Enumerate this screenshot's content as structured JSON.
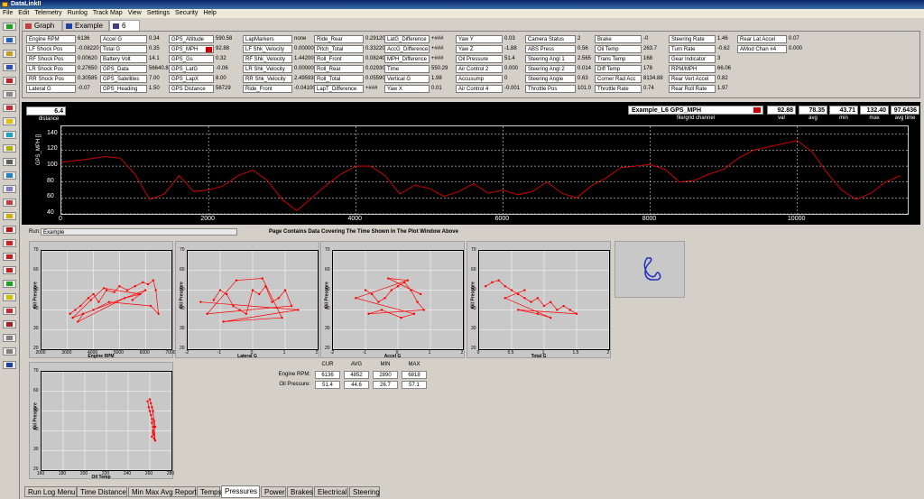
{
  "window": {
    "title": "DataLinkII"
  },
  "menu": [
    "File",
    "Edit",
    "Telemetry",
    "Runlog",
    "Track Map",
    "View",
    "Settings",
    "Security",
    "Help"
  ],
  "tabs": [
    {
      "label": "Graph"
    },
    {
      "label": "Example"
    },
    {
      "label": "6"
    }
  ],
  "channels": [
    {
      "label": "Engine RPM",
      "value": "6136"
    },
    {
      "label": "LF Shock Pos",
      "value": "-0.08220"
    },
    {
      "label": "RF Shock Pos",
      "value": "0.00620"
    },
    {
      "label": "LR Shock Pos",
      "value": "0.27650"
    },
    {
      "label": "RR Shock Pos",
      "value": "0.30585"
    },
    {
      "label": "Lateral G",
      "value": "-0.07"
    },
    {
      "label": "Accel G",
      "value": "0.34"
    },
    {
      "label": "Total G",
      "value": "0.35"
    },
    {
      "label": "Battery Volt",
      "value": "14.1"
    },
    {
      "label": "GPS_Data",
      "value": "56640.85"
    },
    {
      "label": "GPS_Satellites",
      "value": "7.00"
    },
    {
      "label": "GPS_Heading",
      "value": "1.50"
    },
    {
      "label": "GPS_Altitude",
      "value": "590.58"
    },
    {
      "label": "GPS_MPH",
      "value": "92.88"
    },
    {
      "label": "GPS_Gs",
      "value": "0.32"
    },
    {
      "label": "GPS_LatG",
      "value": "-0.06"
    },
    {
      "label": "GPS_LapX",
      "value": "8.00"
    },
    {
      "label": "GPS Distance",
      "value": "56729"
    },
    {
      "label": "LapMarkers",
      "value": "none"
    },
    {
      "label": "LF Shk_Velocity",
      "value": "0.00000"
    },
    {
      "label": "RF Shk_Velocity",
      "value": "1.44200"
    },
    {
      "label": "LR Shk_Velocity",
      "value": "0.00000"
    },
    {
      "label": "RR Shk_Velocity",
      "value": "2.49593"
    },
    {
      "label": "Ride_Front",
      "value": "-0.04100"
    },
    {
      "label": "Ride_Rear",
      "value": "0.29120"
    },
    {
      "label": "Pitch_Total",
      "value": "0.33220"
    },
    {
      "label": "Roll_Front",
      "value": "0.08240"
    },
    {
      "label": "Roll_Rear",
      "value": "0.02930"
    },
    {
      "label": "Roll_Total",
      "value": "0.05590"
    },
    {
      "label": "LapT_Difference",
      "value": "+###"
    },
    {
      "label": "LatG_Difference",
      "value": "+###"
    },
    {
      "label": "AccG_Difference",
      "value": "+###"
    },
    {
      "label": "MPH_Difference",
      "value": "+###"
    },
    {
      "label": "Time",
      "value": "550.29"
    },
    {
      "label": "Vertical G",
      "value": "1.98"
    },
    {
      "label": "Yaw X",
      "value": "0.01"
    },
    {
      "label": "Yaw Y",
      "value": "0.03"
    },
    {
      "label": "Yaw Z",
      "value": "-1.88"
    },
    {
      "label": "Oil Pressure",
      "value": "51.4"
    },
    {
      "label": "Air Control 2",
      "value": "0.000"
    },
    {
      "label": "Accusump",
      "value": "0"
    },
    {
      "label": "Air Control 4",
      "value": "-0.001"
    },
    {
      "label": "Camera Status",
      "value": "2"
    },
    {
      "label": "ABS Press",
      "value": "0.56"
    },
    {
      "label": "Steering Angl 1",
      "value": "2.565"
    },
    {
      "label": "Steering Angl 2",
      "value": "0.014"
    },
    {
      "label": "Steering Angle",
      "value": "0.63"
    },
    {
      "label": "Throttle Pos",
      "value": "101.0"
    },
    {
      "label": "Brake",
      "value": "-0"
    },
    {
      "label": "Oil Temp",
      "value": "263.7"
    },
    {
      "label": "Trans Temp",
      "value": "168"
    },
    {
      "label": "Diff Temp",
      "value": "178"
    },
    {
      "label": "Corner Rad Acc",
      "value": "8134.88"
    },
    {
      "label": "Throttle Rate",
      "value": "0.74"
    },
    {
      "label": "Steering Rate",
      "value": "1.46"
    },
    {
      "label": "Turn Rate",
      "value": "-0.62"
    },
    {
      "label": "Gear Indicator",
      "value": "3"
    },
    {
      "label": "RPM/MPH",
      "value": "66.06"
    },
    {
      "label": "Rear Vert Accel",
      "value": "0.82"
    },
    {
      "label": "Rear Roll Rate",
      "value": "1.97"
    },
    {
      "label": "Rear Lat Accel",
      "value": "0.07"
    },
    {
      "label": "AMod Chan #4",
      "value": "0.000"
    }
  ],
  "graph": {
    "distance_value": "6.4",
    "distance_label": "distance",
    "channel_selector": "Example_L6   GPS_MPH",
    "file_grid_label": "file/grid channel",
    "stats": [
      {
        "label": "val",
        "value": "92.88"
      },
      {
        "label": "avg",
        "value": "78.35"
      },
      {
        "label": "min",
        "value": "43.71"
      },
      {
        "label": "max",
        "value": "132.40"
      },
      {
        "label": "avg time",
        "value": "97.6436"
      }
    ],
    "line_color": "#cc0000",
    "grid_color": "#ffffff"
  },
  "run": {
    "label": "Run:",
    "value": "Example",
    "message": "Page Contains Data Covering The Time Shown In The Plot Window Above"
  },
  "scatter_stats": {
    "headers": [
      "CUR",
      "AVG",
      "MIN",
      "MAX"
    ],
    "rows": [
      {
        "label": "Engine RPM:",
        "values": [
          "6136",
          "4852",
          "2890",
          "6818"
        ]
      },
      {
        "label": "Oil Pressure:",
        "values": [
          "51.4",
          "44.6",
          "26.7",
          "57.1"
        ]
      }
    ]
  },
  "bottom_tabs": [
    {
      "label": "Run Log Menu"
    },
    {
      "label": "Time Distance"
    },
    {
      "label": "Min Max Avg Report"
    },
    {
      "label": "Temps"
    },
    {
      "label": "Pressures"
    },
    {
      "label": "Power"
    },
    {
      "label": "Brakes"
    },
    {
      "label": "Electrical"
    },
    {
      "label": "Steering"
    }
  ],
  "active_tab": "Pressures",
  "chart_data": [
    {
      "type": "line",
      "ylabel": "GPS_MPH []",
      "xlim": [
        0,
        11500
      ],
      "ylim": [
        40,
        150
      ],
      "yticks": [
        40,
        60,
        80,
        100,
        120,
        140
      ],
      "xticks": [
        0,
        2000,
        4000,
        6000,
        8000,
        10000
      ],
      "series": [
        {
          "name": "GPS_MPH",
          "x": [
            0,
            300,
            600,
            800,
            1000,
            1200,
            1400,
            1600,
            1800,
            2000,
            2200,
            2400,
            2600,
            2800,
            3000,
            3200,
            3400,
            3600,
            3800,
            4000,
            4200,
            4400,
            4600,
            4800,
            5000,
            5200,
            5400,
            5600,
            5800,
            6000,
            6200,
            6400,
            6600,
            6800,
            7000,
            7200,
            7400,
            7600,
            7800,
            8000,
            8200,
            8400,
            8600,
            8800,
            9000,
            9200,
            9400,
            9600,
            9800,
            10000,
            10200,
            10400,
            10600,
            10800,
            11000,
            11200,
            11400
          ],
          "y": [
            105,
            108,
            112,
            110,
            90,
            58,
            65,
            88,
            68,
            70,
            75,
            88,
            95,
            82,
            58,
            44,
            60,
            76,
            90,
            100,
            100,
            88,
            65,
            76,
            72,
            62,
            68,
            78,
            66,
            70,
            64,
            68,
            80,
            66,
            60,
            75,
            85,
            98,
            100,
            102,
            96,
            80,
            82,
            90,
            96,
            110,
            120,
            124,
            128,
            132,
            118,
            92,
            70,
            58,
            66,
            80,
            88
          ]
        }
      ]
    },
    {
      "type": "scatter",
      "xlabel": "Engine RPM",
      "ylabel": "Oil Pressure",
      "xlim": [
        2000,
        7000
      ],
      "ylim": [
        20,
        70
      ],
      "xticks": [
        2000,
        3000,
        4000,
        5000,
        6000,
        7000
      ],
      "yticks": [
        20,
        30,
        40,
        50,
        60,
        70
      ],
      "series": [
        {
          "name": "Oil Pressure",
          "points": [
            [
              3100,
              38
            ],
            [
              3300,
              40
            ],
            [
              3500,
              42
            ],
            [
              3800,
              46
            ],
            [
              4000,
              48
            ],
            [
              4200,
              44
            ],
            [
              4500,
              50
            ],
            [
              4800,
              49
            ],
            [
              5000,
              52
            ],
            [
              5300,
              50
            ],
            [
              5600,
              52
            ],
            [
              5900,
              54
            ],
            [
              6100,
              53
            ],
            [
              6300,
              55
            ],
            [
              6400,
              50
            ],
            [
              6500,
              38
            ],
            [
              6200,
              42
            ],
            [
              4600,
              44
            ],
            [
              4000,
              40
            ],
            [
              3600,
              38
            ],
            [
              3400,
              34
            ],
            [
              5200,
              46
            ],
            [
              5800,
              48
            ],
            [
              4400,
              51
            ],
            [
              3900,
              45
            ],
            [
              3200,
              36
            ],
            [
              6000,
              50
            ],
            [
              5500,
              45
            ]
          ]
        }
      ]
    },
    {
      "type": "scatter",
      "xlabel": "Lateral G",
      "ylabel": "Oil Pressure",
      "xlim": [
        -2,
        2
      ],
      "ylim": [
        20,
        70
      ],
      "xticks": [
        -2,
        -1,
        0,
        1,
        2
      ],
      "yticks": [
        20,
        30,
        40,
        50,
        60,
        70
      ],
      "series": [
        {
          "name": "Oil Pressure",
          "points": [
            [
              -1.2,
              45
            ],
            [
              -1.0,
              50
            ],
            [
              -0.8,
              48
            ],
            [
              -0.6,
              42
            ],
            [
              -0.4,
              40
            ],
            [
              -0.2,
              38
            ],
            [
              0,
              50
            ],
            [
              0.2,
              48
            ],
            [
              0.4,
              52
            ],
            [
              0.6,
              44
            ],
            [
              0.8,
              46
            ],
            [
              1.0,
              50
            ],
            [
              1.2,
              42
            ],
            [
              -1.4,
              38
            ],
            [
              -0.5,
              55
            ],
            [
              0.3,
              56
            ],
            [
              0.9,
              36
            ],
            [
              -0.9,
              34
            ],
            [
              1.4,
              40
            ],
            [
              -1.6,
              44
            ]
          ]
        }
      ]
    },
    {
      "type": "scatter",
      "xlabel": "Accel G",
      "ylabel": "Oil Pressure",
      "xlim": [
        -2,
        2
      ],
      "ylim": [
        20,
        70
      ],
      "xticks": [
        -2,
        -1,
        0,
        1,
        2
      ],
      "yticks": [
        20,
        30,
        40,
        50,
        60,
        70
      ],
      "series": [
        {
          "name": "Oil Pressure",
          "points": [
            [
              -1.0,
              50
            ],
            [
              -0.8,
              48
            ],
            [
              -0.6,
              44
            ],
            [
              -0.4,
              46
            ],
            [
              -0.2,
              50
            ],
            [
              0,
              52
            ],
            [
              0.2,
              54
            ],
            [
              0.4,
              50
            ],
            [
              0.6,
              44
            ],
            [
              0.8,
              40
            ],
            [
              -0.9,
              38
            ],
            [
              -0.5,
              40
            ],
            [
              0.1,
              36
            ],
            [
              0.5,
              38
            ],
            [
              -1.3,
              46
            ],
            [
              0.3,
              55
            ],
            [
              -0.3,
              56
            ],
            [
              0.7,
              48
            ]
          ]
        }
      ]
    },
    {
      "type": "scatter",
      "xlabel": "Total G",
      "ylabel": "Oil Pressure",
      "xlim": [
        0,
        2
      ],
      "ylim": [
        20,
        70
      ],
      "xticks": [
        0,
        0.5,
        1,
        1.5,
        2
      ],
      "yticks": [
        20,
        30,
        40,
        50,
        60,
        70
      ],
      "series": [
        {
          "name": "Oil Pressure",
          "points": [
            [
              0.1,
              52
            ],
            [
              0.2,
              54
            ],
            [
              0.3,
              55
            ],
            [
              0.4,
              52
            ],
            [
              0.5,
              50
            ],
            [
              0.6,
              48
            ],
            [
              0.7,
              46
            ],
            [
              0.8,
              44
            ],
            [
              0.9,
              46
            ],
            [
              1.0,
              42
            ],
            [
              1.1,
              44
            ],
            [
              1.2,
              40
            ],
            [
              1.3,
              42
            ],
            [
              1.4,
              40
            ],
            [
              1.5,
              38
            ],
            [
              0.6,
              40
            ],
            [
              0.9,
              38
            ],
            [
              1.1,
              36
            ],
            [
              0.4,
              46
            ],
            [
              0.7,
              50
            ]
          ]
        }
      ]
    },
    {
      "type": "scatter",
      "xlabel": "Oil Temp",
      "ylabel": "Oil Pressure",
      "xlim": [
        160,
        280
      ],
      "ylim": [
        20,
        70
      ],
      "xticks": [
        160,
        180,
        200,
        220,
        240,
        260,
        280
      ],
      "yticks": [
        20,
        30,
        40,
        50,
        60,
        70
      ],
      "series": [
        {
          "name": "Oil Pressure",
          "points": [
            [
              258,
              55
            ],
            [
              259,
              52
            ],
            [
              260,
              50
            ],
            [
              261,
              48
            ],
            [
              262,
              46
            ],
            [
              262,
              44
            ],
            [
              263,
              42
            ],
            [
              263,
              40
            ],
            [
              264,
              38
            ],
            [
              264,
              36
            ],
            [
              265,
              35
            ],
            [
              263,
              50
            ],
            [
              261,
              54
            ],
            [
              260,
              56
            ],
            [
              262,
              52
            ],
            [
              264,
              45
            ],
            [
              265,
              42
            ],
            [
              263,
              39
            ],
            [
              262,
              37
            ]
          ]
        }
      ]
    }
  ]
}
